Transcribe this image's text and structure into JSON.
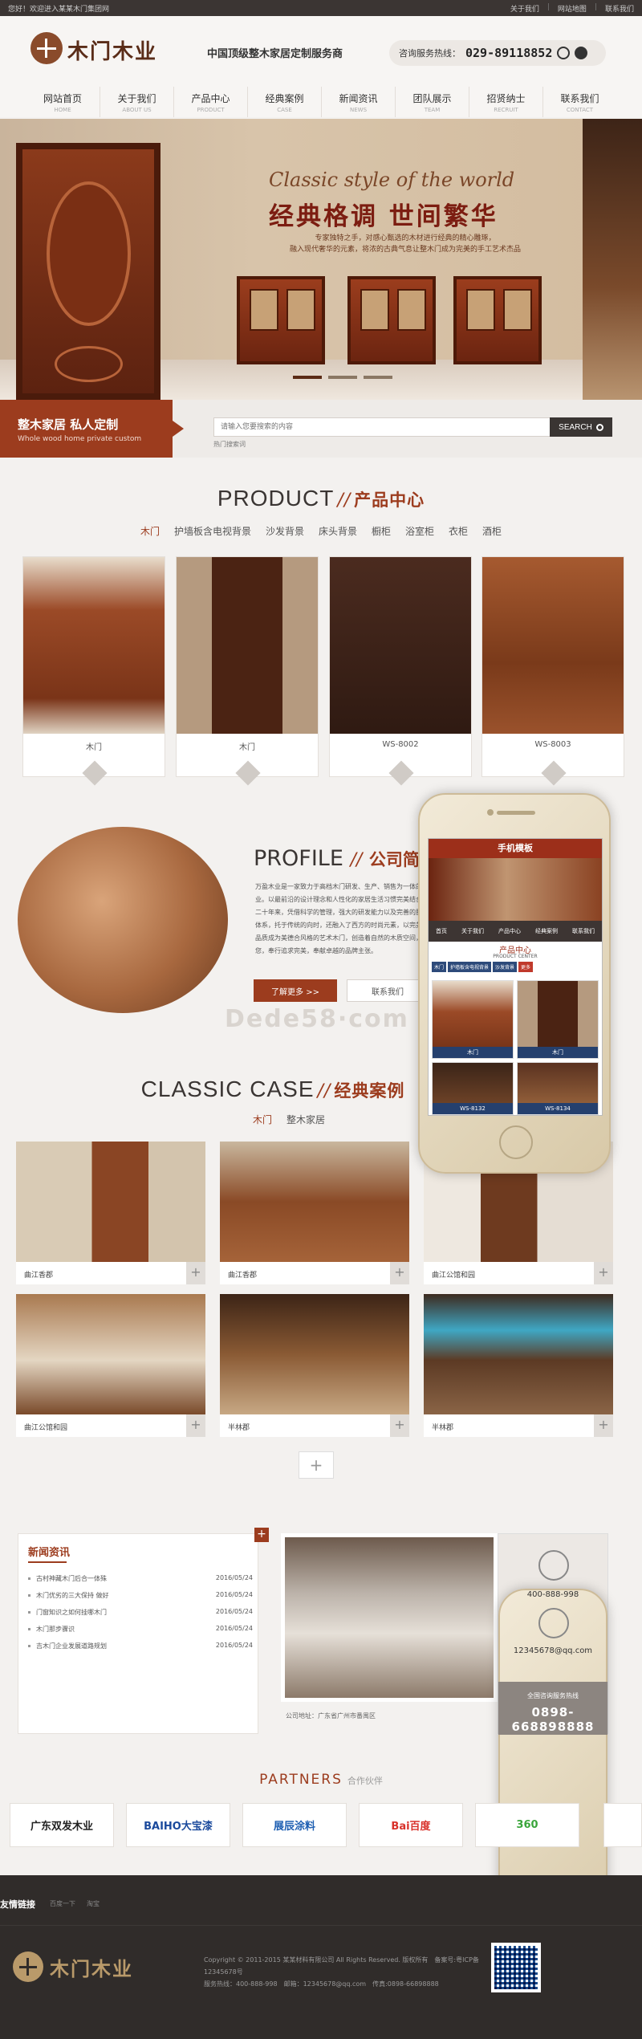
{
  "topbar": {
    "welcome": "您好！欢迎进入某某木门集团网",
    "links": [
      "关于我们",
      "网站地图",
      "联系我们"
    ]
  },
  "header": {
    "logo_text": "木门木业",
    "tagline": "中国顶级整木家居定制服务商",
    "hotline_label": "咨询服务热线：",
    "hotline_number": "029-89118852"
  },
  "nav": [
    {
      "zh": "网站首页",
      "en": "HOME"
    },
    {
      "zh": "关于我们",
      "en": "ABOUT US"
    },
    {
      "zh": "产品中心",
      "en": "PRODUCT"
    },
    {
      "zh": "经典案例",
      "en": "CASE"
    },
    {
      "zh": "新闻资讯",
      "en": "NEWS"
    },
    {
      "zh": "团队展示",
      "en": "TEAM"
    },
    {
      "zh": "招贤纳士",
      "en": "RECRUIT"
    },
    {
      "zh": "联系我们",
      "en": "CONTACT"
    }
  ],
  "banner": {
    "script": "Classic style of the world",
    "title": "经典格调 世间繁华",
    "desc_line1": "专家独特之手，对感心甄选的木材进行经典的精心雕琢，",
    "desc_line2": "融入现代奢华的元素，将浓的古典气息让整木门成为完美的手工艺术杰品"
  },
  "search_strip": {
    "title": "整木家居 私人定制",
    "subtitle": "Whole wood home private custom",
    "placeholder": "请输入您要搜索的内容",
    "button": "SEARCH",
    "hot_words": "热门搜索词"
  },
  "product": {
    "title_en": "PRODUCT",
    "title_zh": "产品中心",
    "tabs": [
      "木门",
      "护墙板含电视背景",
      "沙发背景",
      "床头背景",
      "橱柜",
      "浴室柜",
      "衣柜",
      "酒柜"
    ],
    "items": [
      {
        "caption": "木门"
      },
      {
        "caption": "木门"
      },
      {
        "caption": "WS-8002"
      },
      {
        "caption": "WS-8003"
      }
    ]
  },
  "profile": {
    "title_en": "PROFILE",
    "title_zh": "公司简介",
    "text": "万盈木业是一家致力于高档木门研发、生产、销售为一体的企业。以最前沿的设计理念和人性化的家居生活习惯完美结合，二十年来，凭借科学的管理，强大的研发能力以及完善的服务体系，托于传统的向时，还融入了西方的时尚元素，以完美的品质成为美德合风格的艺术木门，创造着自然的木质空间，为您，奉行追求完美，奉献卓越的品牌主张。",
    "more_button": "了解更多 >>",
    "contact_button": "联系我们",
    "watermark": "Dede58·com"
  },
  "cases": {
    "title_en": "CLASSIC CASE",
    "title_zh": "经典案例",
    "tabs": [
      "木门",
      "整木家居"
    ],
    "items": [
      {
        "caption": "曲江香郡"
      },
      {
        "caption": "曲江香郡"
      },
      {
        "caption": "曲江公馆和园"
      },
      {
        "caption": "曲江公馆和园"
      },
      {
        "caption": "半林郡"
      },
      {
        "caption": "半林郡"
      }
    ],
    "load_more": "+"
  },
  "news": {
    "title": "新闻资讯",
    "items": [
      {
        "title": "古村神藏木门后合一体殊",
        "date": "2016/05/24"
      },
      {
        "title": "木门优劣的三大保持 做好",
        "date": "2016/05/24"
      },
      {
        "title": "门窗知识之如何挂哪木门",
        "date": "2016/05/24"
      },
      {
        "title": "木门那步骤识",
        "date": "2016/05/24"
      },
      {
        "title": "吉木门企业发展道路规划",
        "date": "2016/05/24"
      }
    ]
  },
  "contact": {
    "address": "公司地址：广东省广州市番禺区",
    "phone": "400-888-998",
    "email": "12345678@qq.com",
    "hotline_label": "全国咨询服务热线",
    "hotline_number": "0898-668898888"
  },
  "partners": {
    "title_en": "PARTNERS",
    "title_zh": "合作伙伴",
    "items": [
      {
        "name": "广东双发木业",
        "color": "#222222"
      },
      {
        "name": "BAIHO大宝漆",
        "color": "#1b4a9c"
      },
      {
        "name": "展辰涂料",
        "color": "#1e5fb2"
      },
      {
        "name": "Bai百度",
        "color": "#d8312a"
      },
      {
        "name": "360",
        "color": "#3aa53b"
      }
    ]
  },
  "footer": {
    "links_label": "友情链接",
    "links": [
      "百度一下",
      "淘宝"
    ],
    "logo_text": "木门木业",
    "copyright": "Copyright © 2011-2015 某某材料有限公司 All Rights Reserved. 版权所有　备案号:粤ICP备12345678号",
    "contact_line": "服务热线：400-888-998　邮箱：12345678@qq.com　传真:0898-66898888"
  },
  "phone_mock": {
    "title": "手机模板",
    "tabs": [
      "首页",
      "关于我们",
      "产品中心",
      "经典案例",
      "联系我们"
    ],
    "section_zh": "产品中心",
    "section_en": "PRODUCT CENTER",
    "cats": [
      "木门",
      "护墙板含电视背景",
      "沙发背景",
      "更多"
    ],
    "items": [
      {
        "caption": "木门"
      },
      {
        "caption": "木门"
      },
      {
        "caption": "WS-8132"
      },
      {
        "caption": "WS-8134"
      }
    ]
  },
  "colors": {
    "accent": "#9c3c1e",
    "dark": "#3a3533",
    "footer": "#302c2a"
  }
}
